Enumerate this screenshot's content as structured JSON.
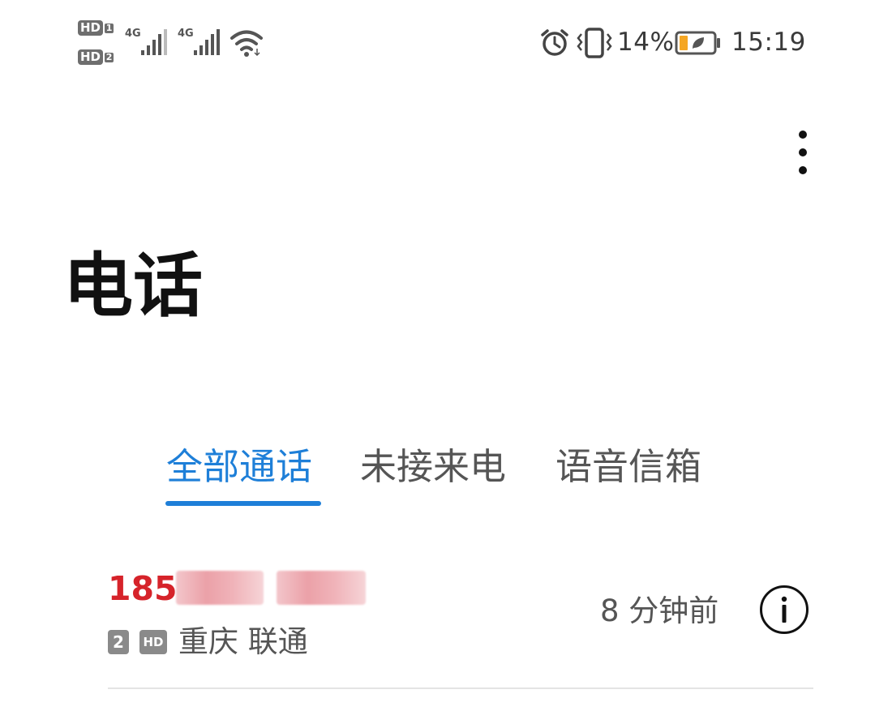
{
  "status_bar": {
    "hd1_label": "HD",
    "hd1_sim": "1",
    "hd2_label": "HD",
    "hd2_sim": "2",
    "sim1_network": "4G",
    "sim2_network": "4G",
    "battery_percent": "14%",
    "battery_level": 0.14,
    "battery_color": "#f5a623",
    "time": "15:19"
  },
  "header": {
    "title": "电话"
  },
  "tabs": [
    {
      "label": "全部通话",
      "active": true
    },
    {
      "label": "未接来电",
      "active": false
    },
    {
      "label": "语音信箱",
      "active": false
    }
  ],
  "accent_color": "#1e7fd8",
  "call_log": [
    {
      "number_visible": "185",
      "sim": "2",
      "hd": "HD",
      "location": "重庆 联通",
      "time_ago": "8 分钟前",
      "missed": true
    }
  ]
}
